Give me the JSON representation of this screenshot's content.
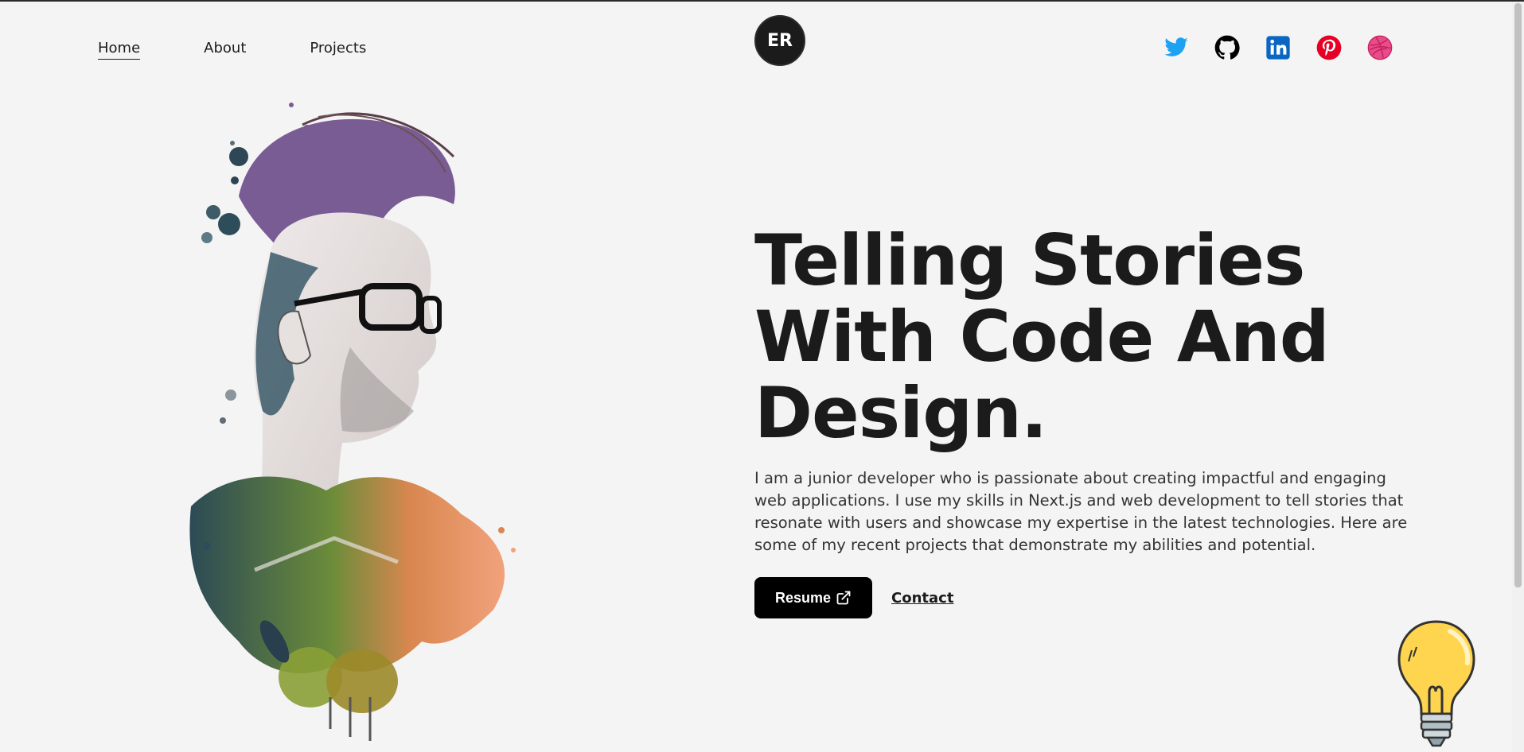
{
  "nav": {
    "links": [
      {
        "label": "Home",
        "active": true
      },
      {
        "label": "About",
        "active": false
      },
      {
        "label": "Projects",
        "active": false
      }
    ],
    "logo_text": "ER",
    "socials": [
      {
        "icon": "twitter-icon",
        "color": "#1DA1F2"
      },
      {
        "icon": "github-icon",
        "color": "#000000"
      },
      {
        "icon": "linkedin-icon",
        "color": "#0A66C2"
      },
      {
        "icon": "pinterest-icon",
        "color": "#E60023"
      },
      {
        "icon": "dribbble-icon",
        "color": "#EA4C89"
      }
    ]
  },
  "hero": {
    "headline": "Telling Stories With Code And Design.",
    "intro": "I am a junior developer who is passionate about creating impactful and engaging web applications. I use my skills in Next.js and web development to tell stories that resonate with users and showcase my expertise in the latest technologies. Here are some of my recent projects that demonstrate my abilities and potential.",
    "resume_label": "Resume",
    "contact_label": "Contact"
  },
  "colors": {
    "background": "#f4f4f4",
    "text": "#1b1b1b",
    "button": "#000000",
    "bulb": "#FFD54F"
  }
}
